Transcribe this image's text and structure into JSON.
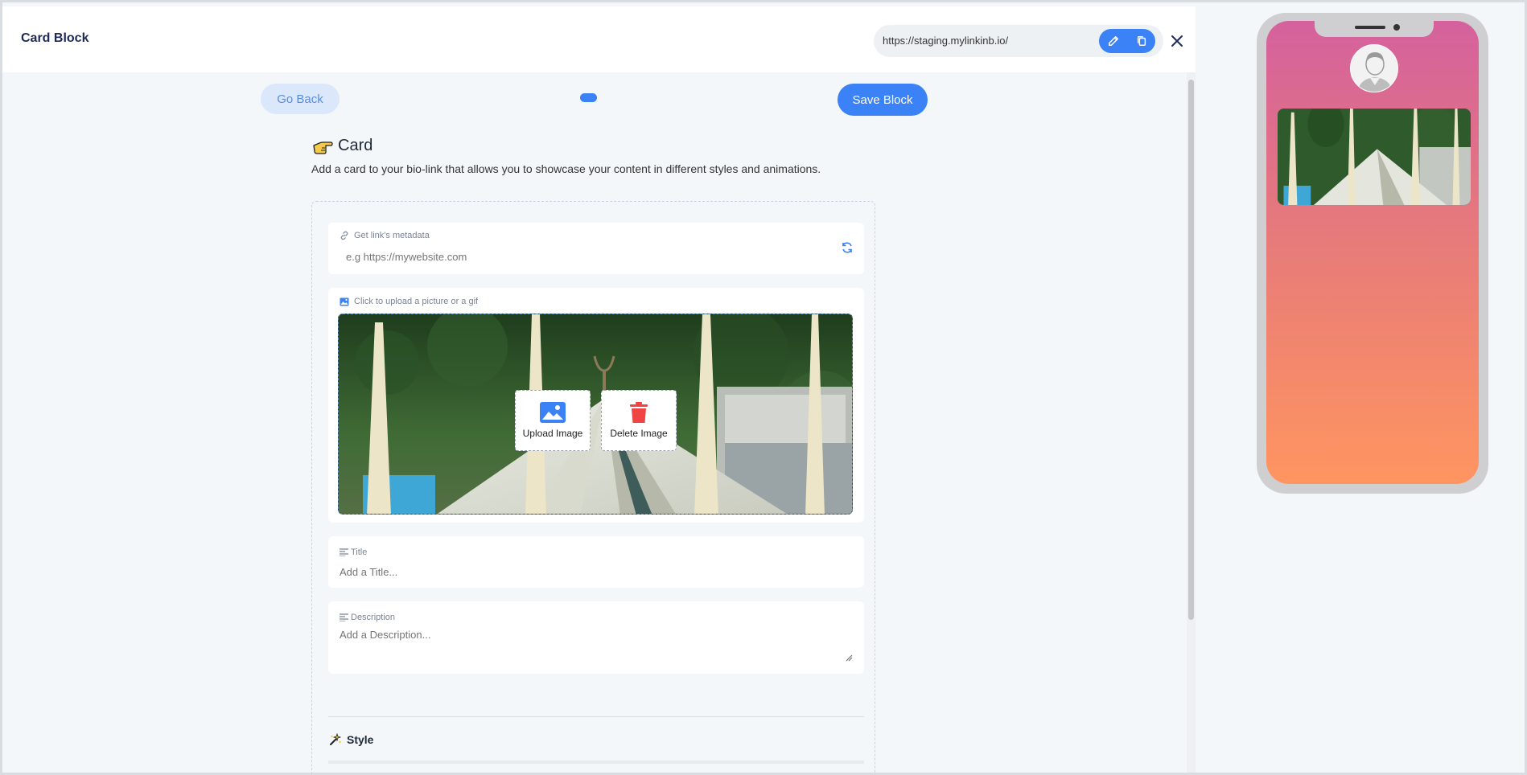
{
  "header": {
    "title": "Card Block",
    "url": "https://staging.mylinkinb.io/"
  },
  "toolbar": {
    "go_back": "Go Back",
    "save_block": "Save Block"
  },
  "card": {
    "heading": "Card",
    "description": "Add a card to your bio-link that allows you to showcase your content in different styles and animations."
  },
  "metadata": {
    "label": "Get link's metadata",
    "placeholder": "e.g https://mywebsite.com"
  },
  "image_upload": {
    "label": "Click to upload a picture or a gif",
    "upload_label": "Upload Image",
    "delete_label": "Delete Image"
  },
  "title_field": {
    "label": "Title",
    "placeholder": "Add a Title..."
  },
  "description_field": {
    "label": "Description",
    "placeholder": "Add a Description..."
  },
  "style": {
    "heading": "Style"
  },
  "colors": {
    "accent": "#3b82f6",
    "delete": "#ef4444",
    "phone_gradient_top": "#d5619d",
    "phone_gradient_bottom": "#ff9560"
  }
}
